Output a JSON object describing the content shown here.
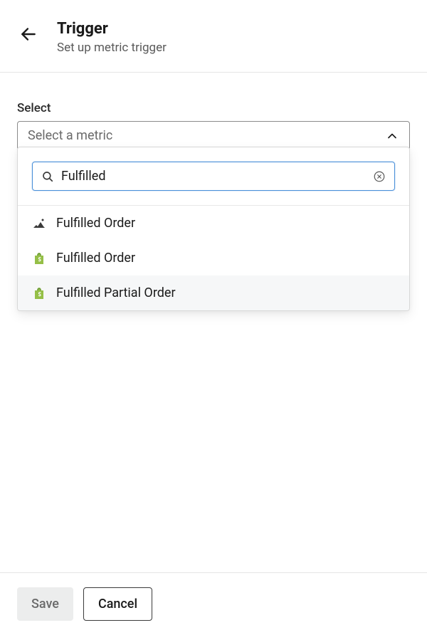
{
  "header": {
    "title": "Trigger",
    "subtitle": "Set up metric trigger"
  },
  "select": {
    "label": "Select",
    "placeholder": "Select a metric"
  },
  "search": {
    "value": "Fulfilled"
  },
  "options": [
    {
      "label": "Fulfilled Order",
      "icon": "custom-metric"
    },
    {
      "label": "Fulfilled Order",
      "icon": "shopify"
    },
    {
      "label": "Fulfilled Partial Order",
      "icon": "shopify"
    }
  ],
  "footer": {
    "save": "Save",
    "cancel": "Cancel"
  }
}
